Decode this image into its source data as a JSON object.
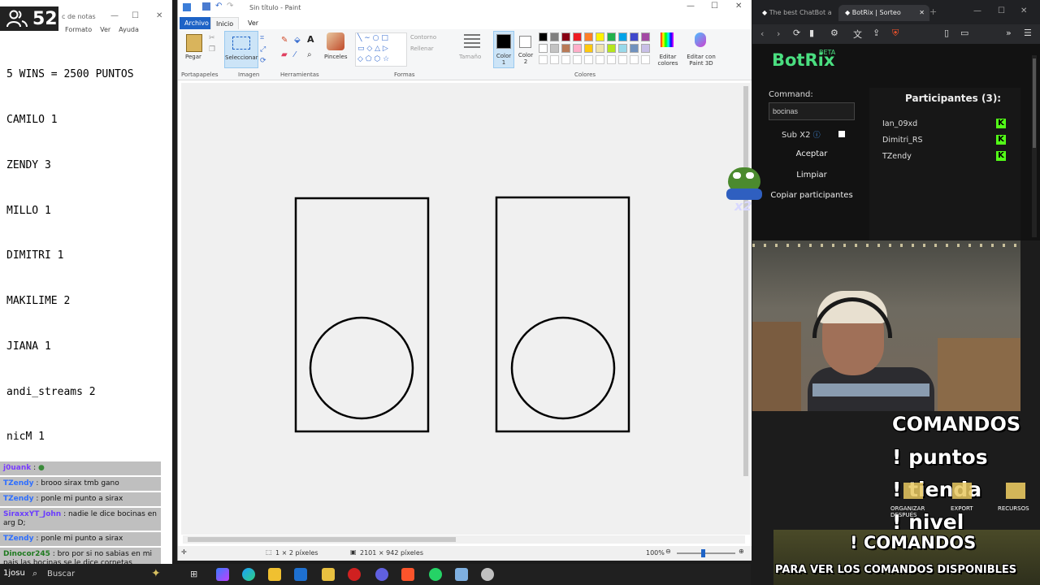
{
  "viewers": {
    "count": "52"
  },
  "notepad": {
    "title": "c de notas",
    "menu": [
      "Formato",
      "Ver",
      "Ayuda"
    ],
    "lines": [
      "5 WINS = 2500 PUNTOS",
      "CAMILO 1",
      "ZENDY 3",
      "MILLO 1",
      "DIMITRI 1",
      "MAKILIME 2",
      "JIANA 1",
      "andi_streams 2",
      "nicM 1"
    ]
  },
  "chat": [
    {
      "user": "j0uank",
      "msg": ":"
    },
    {
      "user": "TZendy",
      "msg": ": brooo sirax tmb gano"
    },
    {
      "user": "TZendy",
      "msg": ": ponle mi punto a sirax"
    },
    {
      "user": "SiraxxYT_John",
      "msg": ": nadie le dice bocinas en arg D;"
    },
    {
      "user": "TZendy",
      "msg": ": ponle mi punto a sirax"
    },
    {
      "user": "Dinocor245",
      "msg": ": bro por si no sabias en mi pais las bocinas se le dice cornetas"
    },
    {
      "user": "1josu",
      "msg": ":"
    }
  ],
  "paint": {
    "title": "Sin título - Paint",
    "tabs": [
      "Archivo",
      "Inicio",
      "Ver"
    ],
    "groups": {
      "clipboard": "Portapapeles",
      "image": "Imagen",
      "tools": "Herramientas",
      "shapes": "Formas",
      "colors": "Colores"
    },
    "buttons": {
      "paste": "Pegar",
      "select": "Seleccionar",
      "brushes": "Pinceles",
      "outline": "Contorno",
      "fill": "Rellenar",
      "size": "Tamaño",
      "color1": "Color 1",
      "color2": "Color 2",
      "edit_colors": "Editar colores",
      "paint3d": "Editar con Paint 3D"
    },
    "palette": [
      "#000000",
      "#7f7f7f",
      "#880015",
      "#ed1c24",
      "#ff7f27",
      "#fff200",
      "#22b14c",
      "#00a2e8",
      "#3f48cc",
      "#a349a4",
      "#ffffff",
      "#c3c3c3",
      "#b97a57",
      "#ffaec9",
      "#ffc90e",
      "#efe4b0",
      "#b5e61d",
      "#99d9ea",
      "#7092be",
      "#c8bfe7"
    ],
    "status": {
      "pixel": "1 × 2 píxeles",
      "size": "2101 × 942 píxeles",
      "zoom": "100%"
    }
  },
  "taskbar": {
    "search": "Buscar"
  },
  "browser": {
    "tabs": [
      "The best ChatBot a",
      "BotRix | Sorteo"
    ],
    "botrix": {
      "logo": "BotRix",
      "beta": "BETA",
      "command_label": "Command:",
      "command_value": "bocinas",
      "subx2": "Sub X2",
      "accept": "Aceptar",
      "clear": "Limpiar",
      "copy": "Copiar participantes",
      "participants_title": "Participantes (3):",
      "participants": [
        "Ian_09xd",
        "Dimitri_RS",
        "TZendy"
      ]
    }
  },
  "overlay": {
    "commands_title": "COMANDOS",
    "cmd1": "! puntos",
    "cmd2": "! tienda",
    "cmd3": "! nivel",
    "folder1": "ORGANIZAR DESPUÉS",
    "folder2": "EXPORT",
    "folder3": "RECURSOS",
    "banner_title": "! COMANDOS",
    "banner_sub": "PARA VER LOS COMANDOS DISPONIBLES",
    "emote_label": "x2"
  }
}
